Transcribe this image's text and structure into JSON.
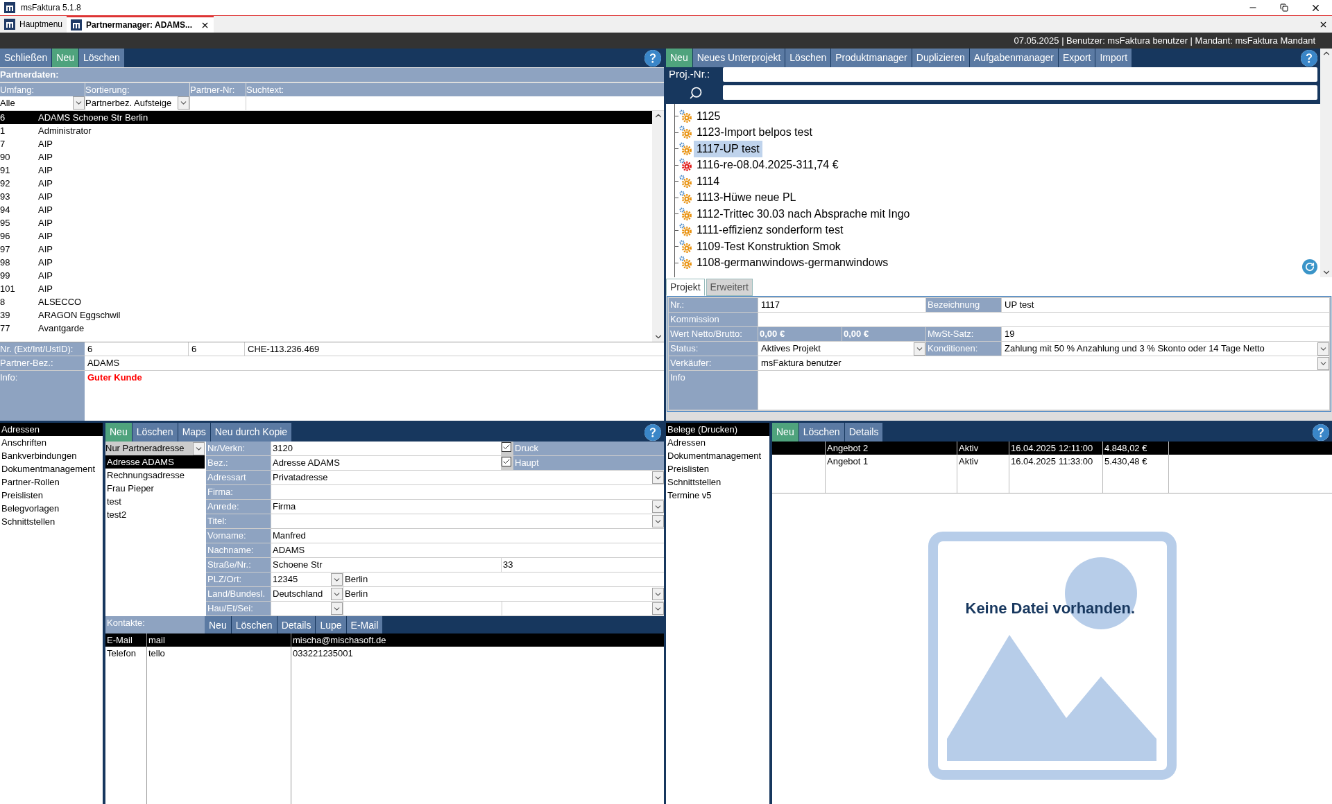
{
  "app": {
    "title": "msFaktura 5.1.8"
  },
  "doc_tabs": [
    {
      "label": "Hauptmenu",
      "selected": false
    },
    {
      "label": "Partnermanager: ADAMS...",
      "selected": true
    }
  ],
  "status_line": "07.05.2025 | Benutzer: msFaktura benutzer | Mandant: msFaktura Mandant",
  "partner_panel": {
    "toolbar": [
      {
        "label": "Schließen",
        "kind": "plain"
      },
      {
        "label": "Neu",
        "kind": "primary"
      },
      {
        "label": "Löschen",
        "kind": "plain"
      }
    ],
    "section_title": "Partnerdaten:",
    "filters": [
      {
        "label": "Umfang:",
        "value": "Alle",
        "kind": "dropdown"
      },
      {
        "label": "Sortierung:",
        "value": "Partnerbez. Aufsteige",
        "kind": "dropdown"
      },
      {
        "label": "Partner-Nr:",
        "kind": "text"
      },
      {
        "label": "Suchtext:",
        "kind": "text"
      }
    ],
    "rows": [
      {
        "nr": "6",
        "name": "ADAMS Schoene Str Berlin",
        "selected": true
      },
      {
        "nr": "1",
        "name": "Administrator",
        "selected": false
      },
      {
        "nr": "7",
        "name": "AIP",
        "selected": false
      },
      {
        "nr": "90",
        "name": "AIP",
        "selected": false
      },
      {
        "nr": "91",
        "name": "AIP",
        "selected": false
      },
      {
        "nr": "92",
        "name": "AIP",
        "selected": false
      },
      {
        "nr": "93",
        "name": "AIP",
        "selected": false
      },
      {
        "nr": "94",
        "name": "AIP",
        "selected": false
      },
      {
        "nr": "95",
        "name": "AIP",
        "selected": false
      },
      {
        "nr": "96",
        "name": "AIP",
        "selected": false
      },
      {
        "nr": "97",
        "name": "AIP",
        "selected": false
      },
      {
        "nr": "98",
        "name": "AIP",
        "selected": false
      },
      {
        "nr": "99",
        "name": "AIP",
        "selected": false
      },
      {
        "nr": "101",
        "name": "AIP",
        "selected": false
      },
      {
        "nr": "8",
        "name": "ALSECCO",
        "selected": false
      },
      {
        "nr": "39",
        "name": "ARAGON Eggschwil",
        "selected": false
      },
      {
        "nr": "77",
        "name": "Avantgarde",
        "selected": false
      }
    ],
    "nr_label": "Nr. (Ext/Int/UstID):",
    "nr_values": [
      "6",
      "6",
      "CHE-113.236.469"
    ],
    "bez_label": "Partner-Bez.:",
    "bez_value": "ADAMS",
    "info_label": "Info:",
    "info_value": "Guter Kunde"
  },
  "project_panel": {
    "toolbar": [
      {
        "label": "Neu",
        "kind": "primary"
      },
      {
        "label": "Neues Unterprojekt",
        "kind": "plain"
      },
      {
        "label": "Löschen",
        "kind": "plain"
      },
      {
        "label": "Produktmanager",
        "kind": "plain"
      },
      {
        "label": "Duplizieren",
        "kind": "plain"
      },
      {
        "label": "Aufgabenmanager",
        "kind": "plain"
      },
      {
        "label": "Export",
        "kind": "plain"
      },
      {
        "label": "Import",
        "kind": "plain"
      }
    ],
    "search_label": "Proj.-Nr.:",
    "tree": [
      {
        "label": "1125",
        "color": "#e8900c",
        "selected": false
      },
      {
        "label": "1123-Import belpos test",
        "color": "#e8900c",
        "selected": false
      },
      {
        "label": "1117-UP test",
        "color": "#e8900c",
        "selected": true
      },
      {
        "label": "1116-re-08.04.2025-311,74 €",
        "color": "#e01818",
        "selected": false
      },
      {
        "label": "1114",
        "color": "#e8900c",
        "selected": false
      },
      {
        "label": "1113-Hüwe neue PL",
        "color": "#e8900c",
        "selected": false
      },
      {
        "label": "1112-Trittec 30.03 nach Absprache mit Ingo",
        "color": "#e8900c",
        "selected": false
      },
      {
        "label": "1111-effizienz sonderform test",
        "color": "#e8900c",
        "selected": false
      },
      {
        "label": "1109-Test Konstruktion Smok",
        "color": "#e8900c",
        "selected": false
      },
      {
        "label": "1108-germanwindows-germanwindows",
        "color": "#e8900c",
        "selected": false
      }
    ],
    "tabs": [
      {
        "label": "Projekt",
        "selected": true
      },
      {
        "label": "Erweitert",
        "selected": false
      }
    ],
    "form": {
      "nr": {
        "label": "Nr.:",
        "value": "1117"
      },
      "bezeichnung": {
        "label": "Bezeichnung",
        "value": "UP test"
      },
      "kommission": {
        "label": "Kommission"
      },
      "wert": {
        "label": "Wert Netto/Brutto:",
        "values": [
          "0,00 €",
          "0,00 €"
        ]
      },
      "mwst": {
        "label": "MwSt-Satz:",
        "value": "19"
      },
      "status": {
        "label": "Status:",
        "value": "Aktives Projekt"
      },
      "konditionen": {
        "label": "Konditionen:",
        "value": "Zahlung mit 50 % Anzahlung und 3 % Skonto oder 14 Tage Netto"
      },
      "verkaeufer": {
        "label": "Verkäufer:",
        "value": "msFaktura benutzer"
      },
      "info": {
        "label": "Info"
      }
    }
  },
  "address_panel": {
    "nav": [
      {
        "label": "Adressen",
        "selected": true
      },
      {
        "label": "Anschriften",
        "selected": false
      },
      {
        "label": "Bankverbindungen",
        "selected": false
      },
      {
        "label": "Dokumentmanagement",
        "selected": false
      },
      {
        "label": "Partner-Rollen",
        "selected": false
      },
      {
        "label": "Preislisten",
        "selected": false
      },
      {
        "label": "Belegvorlagen",
        "selected": false
      },
      {
        "label": "Schnittstellen",
        "selected": false
      }
    ],
    "toolbar": [
      {
        "label": "Neu",
        "kind": "primary"
      },
      {
        "label": "Löschen",
        "kind": "plain"
      },
      {
        "label": "Maps",
        "kind": "plain"
      },
      {
        "label": "Neu durch Kopie",
        "kind": "plain"
      }
    ],
    "filter": "Nur Partneradresse",
    "addresses": [
      {
        "label": "Adresse ADAMS",
        "selected": true
      },
      {
        "label": "Rechnungsadresse",
        "selected": false
      },
      {
        "label": "Frau Pieper",
        "selected": false
      },
      {
        "label": "test",
        "selected": false
      },
      {
        "label": "test2",
        "selected": false
      }
    ],
    "rows": [
      {
        "label": "Nr/Verkn:",
        "cells": [
          {
            "value": "3120",
            "dropdown": false
          }
        ],
        "check": {
          "label": "Druck",
          "checked": true
        }
      },
      {
        "label": "Bez.:",
        "cells": [
          {
            "value": "Adresse ADAMS",
            "dropdown": false
          }
        ],
        "check": {
          "label": "Haupt",
          "checked": true
        }
      },
      {
        "label": "Adressart",
        "cells": [
          {
            "value": "Privatadresse",
            "dropdown": true
          }
        ]
      },
      {
        "label": "Firma:",
        "cells": [
          {
            "dropdown": false
          }
        ]
      },
      {
        "label": "Anrede:",
        "cells": [
          {
            "value": "Firma",
            "dropdown": true
          }
        ]
      },
      {
        "label": "Titel:",
        "cells": [
          {
            "dropdown": true
          }
        ]
      },
      {
        "label": "Vorname:",
        "cells": [
          {
            "value": "Manfred",
            "dropdown": false
          }
        ]
      },
      {
        "label": "Nachname:",
        "cells": [
          {
            "value": "ADAMS",
            "dropdown": false
          }
        ]
      },
      {
        "label": "Straße/Nr.:",
        "cells": [
          {
            "value": "Schoene Str",
            "dropdown": false
          },
          {
            "value": "33",
            "dropdown": false
          }
        ]
      },
      {
        "label": "PLZ/Ort:",
        "cells": [
          {
            "value": "12345",
            "dropdown": true
          },
          {
            "value": "Berlin",
            "dropdown": false
          }
        ]
      },
      {
        "label": "Land/Bundesl.",
        "cells": [
          {
            "value": "Deutschland",
            "dropdown": true
          },
          {
            "value": "Berlin",
            "dropdown": true
          }
        ]
      },
      {
        "label": "Hau/Et/Sei:",
        "cells": [
          {
            "dropdown": true
          },
          {
            "dropdown": false
          },
          {
            "dropdown": true
          }
        ]
      }
    ],
    "contacts_label": "Kontakte:",
    "contacts_toolbar": [
      {
        "label": "Neu",
        "kind": "plain"
      },
      {
        "label": "Löschen",
        "kind": "plain"
      },
      {
        "label": "Details",
        "kind": "plain"
      },
      {
        "label": "Lupe",
        "kind": "plain"
      },
      {
        "label": "E-Mail",
        "kind": "plain"
      }
    ],
    "contacts": [
      {
        "type": "E-Mail",
        "name": "mail",
        "value": "mischa@mischasoft.de",
        "selected": true
      },
      {
        "type": "Telefon",
        "name": "tello",
        "value": "033221235001",
        "selected": false
      }
    ]
  },
  "documents_panel": {
    "nav": [
      {
        "label": "Belege (Drucken)",
        "selected": true
      },
      {
        "label": "Adressen",
        "selected": false
      },
      {
        "label": "Dokumentmanagement",
        "selected": false
      },
      {
        "label": "Preislisten",
        "selected": false
      },
      {
        "label": "Schnittstellen",
        "selected": false
      },
      {
        "label": "Termine v5",
        "selected": false
      }
    ],
    "toolbar": [
      {
        "label": "Neu",
        "kind": "primary"
      },
      {
        "label": "Löschen",
        "kind": "plain"
      },
      {
        "label": "Details",
        "kind": "plain"
      }
    ],
    "rows": [
      {
        "name": "Angebot 2",
        "status": "Aktiv",
        "date": "16.04.2025 12:11:00",
        "amount": "4.848,02 €",
        "selected": true
      },
      {
        "name": "Angebot 1",
        "status": "Aktiv",
        "date": "16.04.2025 11:33:00",
        "amount": "5.430,48 €",
        "selected": false
      }
    ],
    "preview_message": "Keine Datei vorhanden."
  }
}
